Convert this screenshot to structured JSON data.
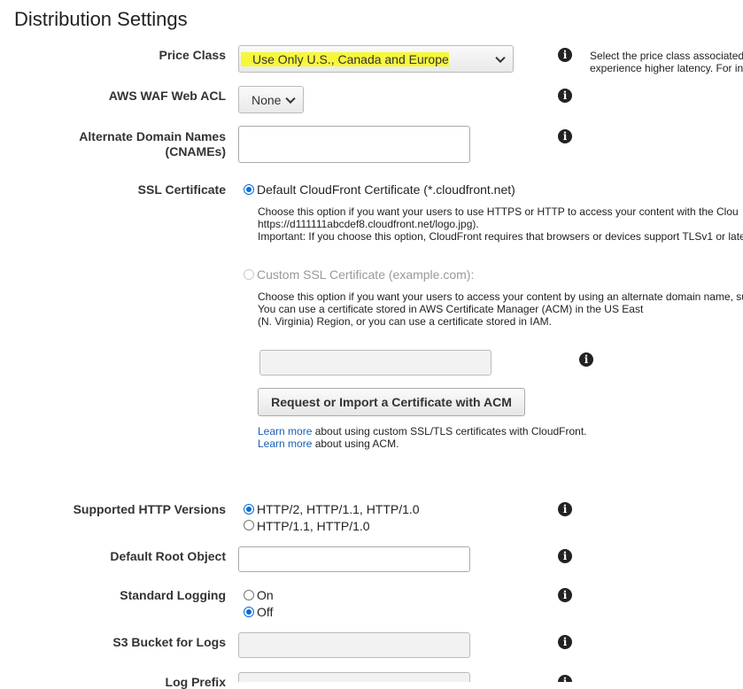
{
  "page_title": "Distribution Settings",
  "price_class": {
    "label": "Price Class",
    "value": "Use Only U.S., Canada and Europe",
    "help": [
      "Select the price class associated",
      "experience higher latency. For in"
    ]
  },
  "waf": {
    "label": "AWS WAF Web ACL",
    "value": "None"
  },
  "cnames": {
    "label_line1": "Alternate Domain Names",
    "label_line2": "(CNAMEs)",
    "value": ""
  },
  "ssl": {
    "label": "SSL Certificate",
    "default_option": "Default CloudFront Certificate (*.cloudfront.net)",
    "default_desc": [
      "Choose this option if you want your users to use HTTPS or HTTP to access your content with the Clou",
      "https://d111111abcdef8.cloudfront.net/logo.jpg).",
      "Important: If you choose this option, CloudFront requires that browsers or devices support TLSv1 or late"
    ],
    "custom_option": "Custom SSL Certificate (example.com):",
    "custom_desc": [
      "Choose this option if you want your users to access your content by using an alternate domain name, su",
      "You can use a certificate stored in AWS Certificate Manager (ACM) in the US East",
      "(N. Virginia) Region, or you can use a certificate stored in IAM."
    ],
    "custom_value": "",
    "acm_button": "Request or Import a Certificate with ACM",
    "learn1_link": "Learn more",
    "learn1_text": " about using custom SSL/TLS certificates with CloudFront.",
    "learn2_link": "Learn more",
    "learn2_text": " about using ACM."
  },
  "http_versions": {
    "label": "Supported HTTP Versions",
    "opt1": "HTTP/2, HTTP/1.1, HTTP/1.0",
    "opt2": "HTTP/1.1, HTTP/1.0"
  },
  "root_object": {
    "label": "Default Root Object",
    "value": ""
  },
  "logging": {
    "label": "Standard Logging",
    "on": "On",
    "off": "Off"
  },
  "s3_bucket": {
    "label": "S3 Bucket for Logs",
    "value": ""
  },
  "log_prefix": {
    "label": "Log Prefix"
  },
  "icons": {
    "info": "info-icon",
    "dropdown": "chevron-down-icon"
  },
  "colors": {
    "highlight": "#f7f73a",
    "link": "#1a5fb4",
    "radio": "#0a6cd8"
  }
}
